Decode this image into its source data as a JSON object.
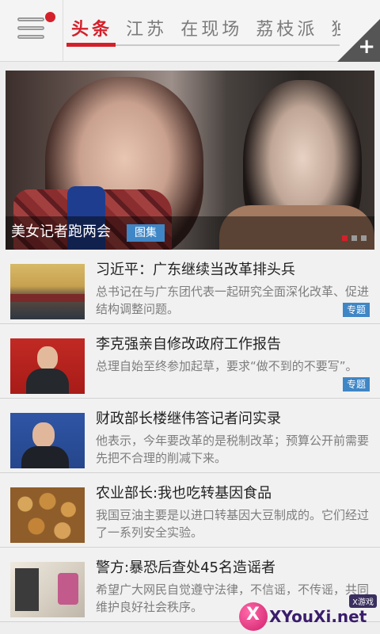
{
  "header": {
    "tabs": [
      {
        "label": "头条",
        "active": true
      },
      {
        "label": "江苏",
        "active": false
      },
      {
        "label": "在现场",
        "active": false
      },
      {
        "label": "荔枝派",
        "active": false
      },
      {
        "label": "独家",
        "active": false
      }
    ],
    "add_label": "+"
  },
  "hero": {
    "title": "美女记者跑两会",
    "badge": "图集",
    "pager_total": 3,
    "pager_current": 1
  },
  "news": [
    {
      "title": "习近平：广东继续当改革排头兵",
      "summary": "总书记在与广东团代表一起研究全面深化改革、促进结构调整问题。",
      "tag": "专题"
    },
    {
      "title": "李克强亲自修改政府工作报告",
      "summary": "总理自始至终参加起草，要求“做不到的不要写”。",
      "tag": "专题"
    },
    {
      "title": "财政部长楼继伟答记者问实录",
      "summary": "他表示，今年要改革的是税制改革；预算公开前需要先把不合理的削减下来。",
      "tag": ""
    },
    {
      "title": "农业部长:我也吃转基因食品",
      "summary": "我国豆油主要是以进口转基因大豆制成的。它们经过了一系列安全实验。",
      "tag": ""
    },
    {
      "title": "警方:暴恐后查处45名造谣者",
      "summary": "希望广大网民自觉遵守法律，不信谣，不传谣，共同维护良好社会秩序。",
      "tag": ""
    }
  ],
  "watermark": {
    "site": "XYouXi.net",
    "bubble": "X游戏",
    "logo_letter": "X"
  }
}
